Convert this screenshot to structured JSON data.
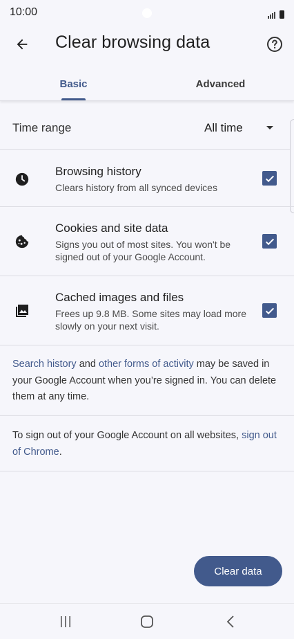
{
  "status_bar": {
    "time": "10:00",
    "icons": [
      "signal-icon",
      "battery-icon"
    ]
  },
  "app_bar": {
    "title": "Clear browsing data",
    "back_icon": "arrow-back-icon",
    "help_icon": "help-circle-icon"
  },
  "tabs": [
    {
      "label": "Basic",
      "selected": true
    },
    {
      "label": "Advanced",
      "selected": false
    }
  ],
  "time_range": {
    "label": "Time range",
    "value": "All time"
  },
  "options": [
    {
      "icon": "clock-icon",
      "title": "Browsing history",
      "description": "Clears history from all synced devices",
      "checked": true
    },
    {
      "icon": "cookie-icon",
      "title": "Cookies and site data",
      "description": "Signs you out of most sites. You won't be signed out of your Google Account.",
      "checked": true
    },
    {
      "icon": "image-icon",
      "title": "Cached images and files",
      "description": "Frees up 9.8 MB. Some sites may load more slowly on your next visit.",
      "checked": true
    }
  ],
  "info": {
    "search_history_link": "Search history",
    "and": " and ",
    "other_forms_link": "other forms of activity",
    "rest": " may be saved in your Google Account when you’re signed in. You can delete them at any time.",
    "sign_out_text": "To sign out of your Google Account on all websites, ",
    "sign_out_link": "sign out of Chrome",
    "period": "."
  },
  "clear_button": {
    "label": "Clear data"
  },
  "nav_bar": {
    "buttons": [
      "recents-icon",
      "home-icon",
      "back-nav-icon"
    ]
  },
  "colors": {
    "accent": "#425a8c",
    "background": "#f6f6fb",
    "divider": "#dcdce2"
  }
}
